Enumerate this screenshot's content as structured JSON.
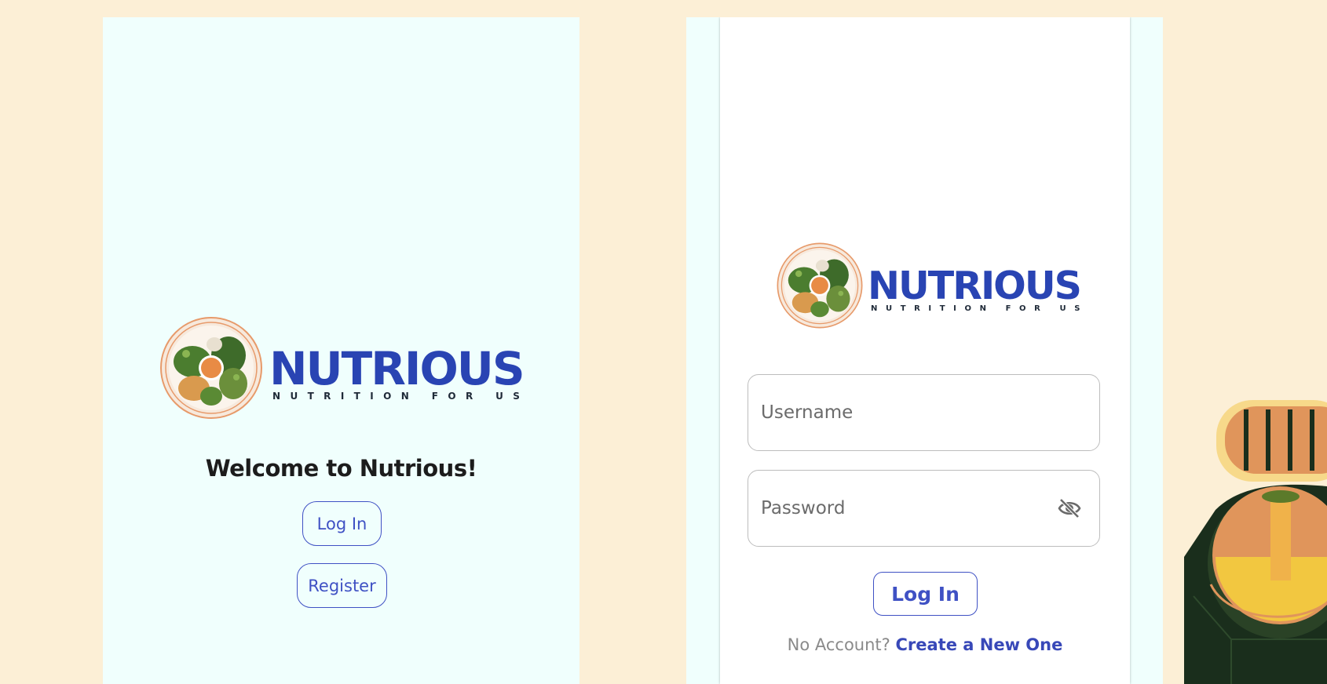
{
  "colors": {
    "page_background": "#fcefd6",
    "panel_background": "#f0fffd",
    "card_background": "#ffffff",
    "brand_blue": "#2944b3",
    "button_accent": "#3f51c4",
    "link_accent": "#3848b8"
  },
  "welcome_screen": {
    "logo": {
      "wordmark": "NUTRIOUS",
      "tagline": "NUTRITION FOR US",
      "emblem_icon": "food-plate-icon"
    },
    "heading": "Welcome to Nutrious!",
    "login_button_label": "Log In",
    "register_button_label": "Register"
  },
  "login_screen": {
    "logo": {
      "wordmark": "NUTRIOUS",
      "tagline": "NUTRITION FOR US",
      "emblem_icon": "food-plate-icon"
    },
    "username_placeholder": "Username",
    "password_placeholder": "Password",
    "password_toggle_icon": "eye-off-icon",
    "login_button_label": "Log In",
    "account_prompt": "No Account?",
    "create_account_link": "Create a New One"
  },
  "decoration": {
    "icon": "lantern-figure-icon"
  }
}
